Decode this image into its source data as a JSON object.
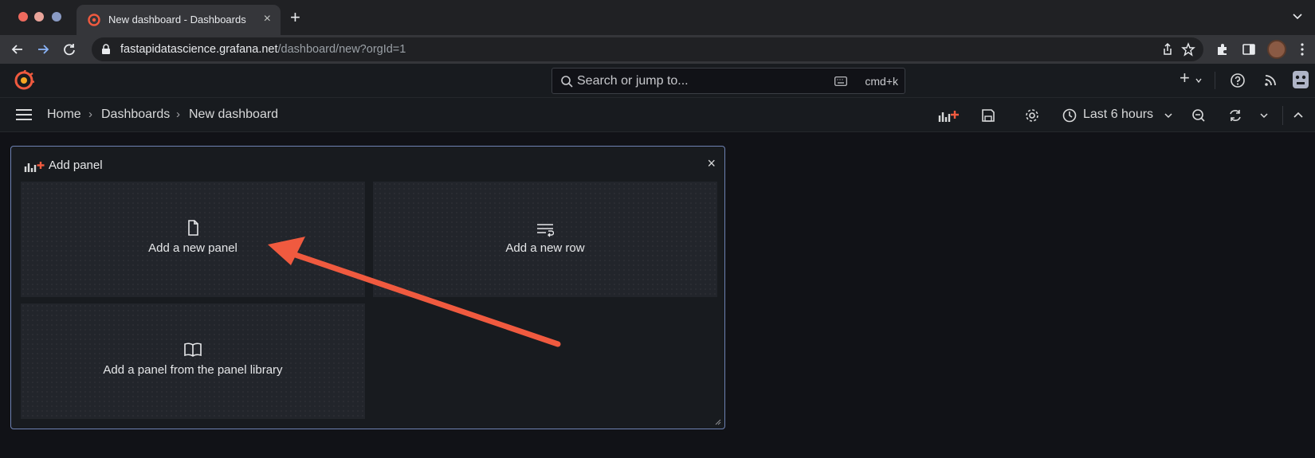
{
  "browser": {
    "tab_title": "New dashboard - Dashboards",
    "tab_close": "×",
    "new_tab": "+",
    "url_host": "fastapidatascience.grafana.net",
    "url_path": "/dashboard/new?orgId=1"
  },
  "topbar": {
    "search_placeholder": "Search or jump to...",
    "search_shortcut": "cmd+k",
    "plus_label": "+"
  },
  "breadcrumb": {
    "items": [
      "Home",
      "Dashboards",
      "New dashboard"
    ],
    "separator": "›"
  },
  "toolbar": {
    "time_range": "Last 6 hours"
  },
  "add_panel": {
    "title": "Add panel",
    "close": "×",
    "options": [
      {
        "label": "Add a new panel",
        "icon": "file-icon"
      },
      {
        "label": "Add a new row",
        "icon": "row-icon"
      },
      {
        "label": "Add a panel from the panel library",
        "icon": "book-icon"
      }
    ]
  },
  "colors": {
    "accent": "#f05a3f",
    "panel_border": "#6e82b3",
    "background": "#111217"
  }
}
